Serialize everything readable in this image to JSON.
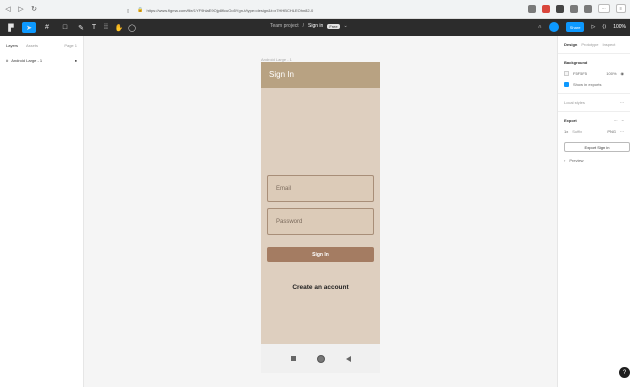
{
  "browser": {
    "url": "https://www.figma.com/file/1YF9hlaE9Ojp8flcuOo5Ygn-t/type=design&t=x7HHBCHLEOhn82-0"
  },
  "toolbar": {
    "project": "Team project",
    "file_name": "Sign in",
    "badge": "Free",
    "share_label": "Share",
    "zoom": "100%"
  },
  "left_panel": {
    "tabs": [
      "Layers",
      "Assets",
      "Page 1"
    ],
    "layers": [
      {
        "label": "Android Large - 1"
      }
    ]
  },
  "right_panel": {
    "tabs": [
      "Design",
      "Prototype",
      "Inspect"
    ],
    "background_title": "Background",
    "background_value": "F5F5F5",
    "background_opacity": "100%",
    "show_in_exports": "Show in exports",
    "local_styles": "Local styles",
    "export_title": "Export",
    "export_scale": "1x",
    "export_suffix": "Suffix",
    "export_format": "PNG",
    "export_button": "Export Sign in",
    "preview": "Preview"
  },
  "frame": {
    "label": "Android Large - 1"
  },
  "app": {
    "title": "Sign In",
    "email_placeholder": "Email",
    "password_placeholder": "Password",
    "sign_in_button": "Sign In",
    "create_account": "Create an account"
  },
  "colors": {
    "app_bar": "#b8a282",
    "screen_bg": "#decfbf",
    "button": "#a47c62",
    "accent": "#0d99ff"
  }
}
